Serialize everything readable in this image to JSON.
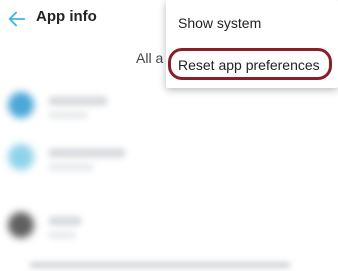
{
  "header": {
    "title": "App info",
    "back_icon": "arrow-left-icon"
  },
  "filter": {
    "label": "All a"
  },
  "overflow_menu": {
    "items": [
      {
        "label": "Show system"
      },
      {
        "label": "Reset app preferences"
      }
    ],
    "highlight_color": "#8a1f2a"
  },
  "colors": {
    "accent": "#3fb6e0",
    "background": "#ffffff"
  }
}
